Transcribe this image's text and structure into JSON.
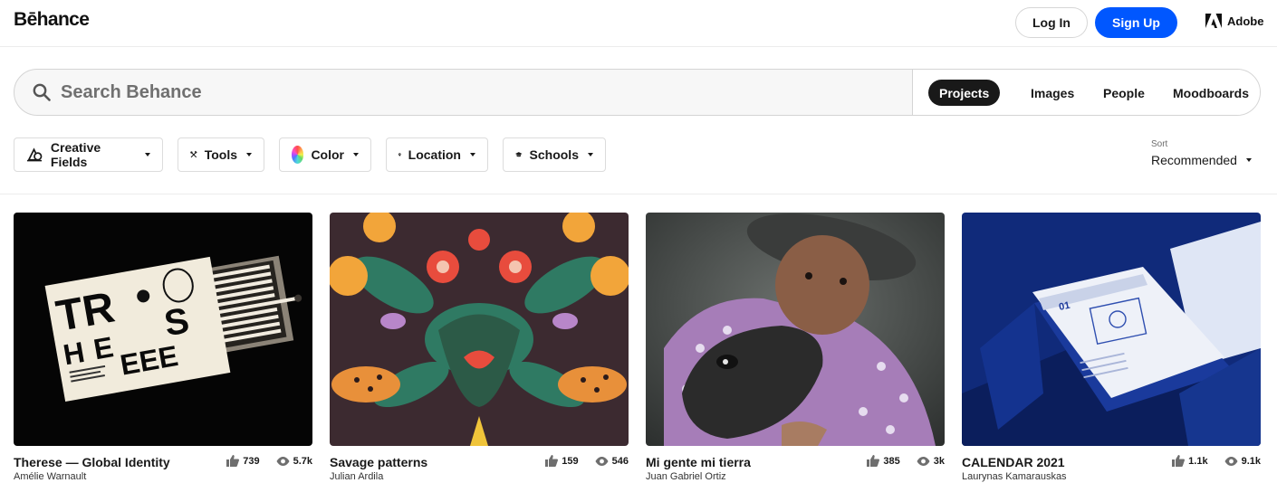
{
  "header": {
    "logo": "Bēhance",
    "login_label": "Log In",
    "signup_label": "Sign Up",
    "adobe_label": "Adobe"
  },
  "search": {
    "placeholder": "Search Behance",
    "tabs": [
      {
        "label": "Projects",
        "active": true
      },
      {
        "label": "Images",
        "active": false
      },
      {
        "label": "People",
        "active": false
      },
      {
        "label": "Moodboards",
        "active": false
      }
    ]
  },
  "filters": [
    {
      "label": "Creative Fields",
      "icon": "creative-fields-icon"
    },
    {
      "label": "Tools",
      "icon": "tools-icon"
    },
    {
      "label": "Color",
      "icon": "color-wheel-icon"
    },
    {
      "label": "Location",
      "icon": "location-pin-icon"
    },
    {
      "label": "Schools",
      "icon": "graduation-cap-icon"
    }
  ],
  "sort": {
    "label": "Sort",
    "value": "Recommended"
  },
  "projects": [
    {
      "title": "Therese — Global Identity",
      "author": "Amélie Warnault",
      "likes": "739",
      "views": "5.7k"
    },
    {
      "title": "Savage patterns",
      "author": "Julian Ardila",
      "likes": "159",
      "views": "546"
    },
    {
      "title": "Mi gente mi tierra",
      "author": "Juan Gabriel Ortiz",
      "likes": "385",
      "views": "3k"
    },
    {
      "title": "CALENDAR 2021",
      "author": "Laurynas Kamarauskas",
      "likes": "1.1k",
      "views": "9.1k"
    }
  ],
  "colors": {
    "accent": "#0057ff",
    "active_tab": "#191919"
  }
}
